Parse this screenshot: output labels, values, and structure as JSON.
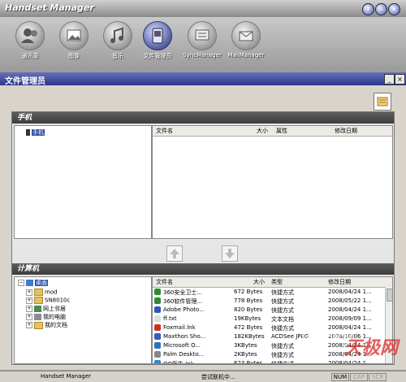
{
  "window": {
    "title": "Handset Manager"
  },
  "toolbar": {
    "items": [
      {
        "label": "通讯录"
      },
      {
        "label": "图像"
      },
      {
        "label": "音乐"
      },
      {
        "label": "文件管理员"
      },
      {
        "label": "SyncManager"
      },
      {
        "label": "MailManager"
      }
    ]
  },
  "panel": {
    "title": "文件管理员"
  },
  "phone": {
    "header": "手机",
    "tree_root": "手机",
    "columns": [
      "文件名",
      "大小",
      "属性",
      "修改日期"
    ]
  },
  "computer": {
    "header": "计算机",
    "tree": [
      {
        "label": "桌面",
        "selected": true
      },
      {
        "label": "mod"
      },
      {
        "label": "SN8010c"
      },
      {
        "label": "网上邻居"
      },
      {
        "label": "我的电脑"
      },
      {
        "label": "我的文档"
      }
    ],
    "columns": [
      "文件名",
      "大小",
      "类型",
      "修改日期"
    ],
    "rows": [
      {
        "name": "360安全卫士...",
        "size": "672 Bytes",
        "type": "快捷方式",
        "date": "2008/04/24 1...",
        "color": "#2e8b2e"
      },
      {
        "name": "360软件管理...",
        "size": "778 Bytes",
        "type": "快捷方式",
        "date": "2008/05/22 1...",
        "color": "#2e8b2e"
      },
      {
        "name": "Adobe Photo...",
        "size": "820 Bytes",
        "type": "快捷方式",
        "date": "2008/04/24 1...",
        "color": "#2a5bb0"
      },
      {
        "name": "ff.txt",
        "size": "19KBytes",
        "type": "文本文档",
        "date": "2008/09/09 1...",
        "color": "#dddddd"
      },
      {
        "name": "Foxmail.lnk",
        "size": "472 Bytes",
        "type": "快捷方式",
        "date": "2008/04/24 1...",
        "color": "#d03020"
      },
      {
        "name": "Maxthon Sho...",
        "size": "182KBytes",
        "type": "ACDSee JPEG",
        "date": "2008/10/06 1...",
        "color": "#3060c0"
      },
      {
        "name": "Microsoft O...",
        "size": "3KBytes",
        "type": "快捷方式",
        "date": "2008/04/24 1...",
        "color": "#3070c0"
      },
      {
        "name": "Palm Deskto...",
        "size": "2KBytes",
        "type": "快捷方式",
        "date": "2008/04/24 1...",
        "color": "#888888"
      },
      {
        "name": "QQ医生.lnk",
        "size": "623 Bytes",
        "type": "快捷方式",
        "date": "2008/04/24 1...",
        "color": "#2a8acb"
      }
    ]
  },
  "status": {
    "left": "Handset Manager",
    "center": "尝试联机中...",
    "indicators": [
      "NUM",
      "CAP",
      "SCR"
    ]
  },
  "watermark": {
    "text1": "yesky",
    "text2": "天极网"
  }
}
